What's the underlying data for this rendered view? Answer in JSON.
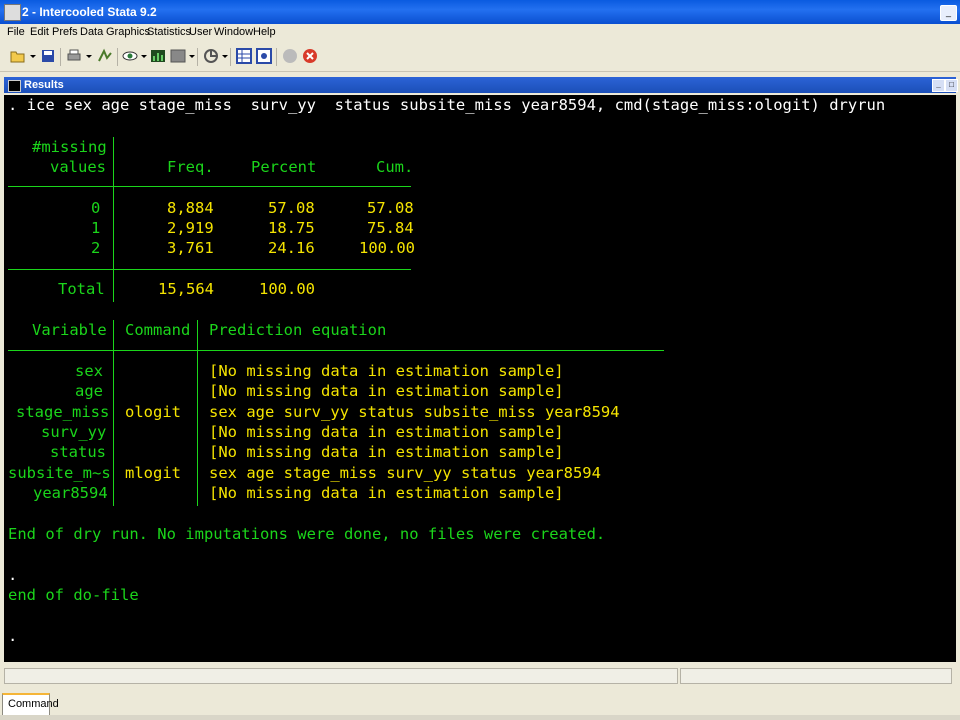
{
  "window": {
    "title": "2 - Intercooled Stata 9.2"
  },
  "menu": [
    "File",
    "Edit",
    "Prefs",
    "Data",
    "Graphics",
    "Statistics",
    "User",
    "Window",
    "Help"
  ],
  "toolbar": {
    "icons": [
      "open-icon",
      "save-icon",
      "print-icon",
      "log-icon",
      "viewer-icon",
      "graph-icon",
      "dofile-editor-icon",
      "data-editor-icon",
      "data-browser-icon",
      "go-icon",
      "break-icon"
    ]
  },
  "results": {
    "title": "Results",
    "command": ". ice sex age stage_miss  surv_yy  status subsite_miss year8594, cmd(stage_miss:ologit) dryrun",
    "table1": {
      "header1": "#missing",
      "header2": "values",
      "col_freq": "Freq.",
      "col_percent": "Percent",
      "col_cum": "Cum.",
      "rows": [
        {
          "value": "0",
          "freq": "8,884",
          "percent": "57.08",
          "cum": "57.08"
        },
        {
          "value": "1",
          "freq": "2,919",
          "percent": "18.75",
          "cum": "75.84"
        },
        {
          "value": "2",
          "freq": "3,761",
          "percent": "24.16",
          "cum": "100.00"
        }
      ],
      "total_label": "Total",
      "total_freq": "15,564",
      "total_percent": "100.00"
    },
    "table2": {
      "col_variable": "Variable",
      "col_command": "Command",
      "col_equation": "Prediction equation",
      "rows": [
        {
          "variable": "sex",
          "command": "",
          "equation": "[No missing data in estimation sample]"
        },
        {
          "variable": "age",
          "command": "",
          "equation": "[No missing data in estimation sample]"
        },
        {
          "variable": "stage_miss",
          "command": "ologit",
          "equation": "sex age surv_yy status subsite_miss year8594"
        },
        {
          "variable": "surv_yy",
          "command": "",
          "equation": "[No missing data in estimation sample]"
        },
        {
          "variable": "status",
          "command": "",
          "equation": "[No missing data in estimation sample]"
        },
        {
          "variable": "subsite_m~s",
          "command": "mlogit",
          "equation": "sex age stage_miss surv_yy status year8594"
        },
        {
          "variable": "year8594",
          "command": "",
          "equation": "[No missing data in estimation sample]"
        }
      ]
    },
    "dry_run_msg": "End of dry run. No imputations were done, no files were created.",
    "dot1": ".",
    "end_msg": "end of do-file",
    "dot2": "."
  },
  "command_tab": {
    "label": "Command"
  },
  "colors": {
    "text_green": "#1bd51b",
    "text_yellow": "#f5e400",
    "text_white": "#ffffff",
    "background": "#000000"
  }
}
